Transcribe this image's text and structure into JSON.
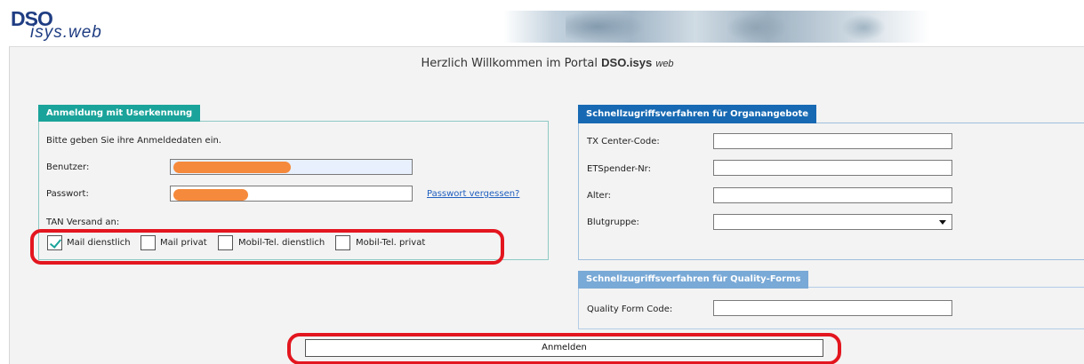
{
  "header": {
    "logo_top": "DSO",
    "logo_bottom": "isys.web",
    "photo": "header-banner-photo"
  },
  "welcome": {
    "prefix": "Herzlich Willkommen im Portal ",
    "brand": "DSO.isys",
    "suffix": "web"
  },
  "login_panel": {
    "tab": "Anmeldung mit Userkennung",
    "intro": "Bitte geben Sie ihre Anmeldedaten ein.",
    "user_label": "Benutzer:",
    "user_value": "",
    "password_label": "Passwort:",
    "password_value": "",
    "forgot_link": "Passwort vergessen?",
    "tan_label": "TAN Versand an:",
    "tan_options": [
      {
        "label": "Mail dienstlich",
        "checked": true
      },
      {
        "label": "Mail privat",
        "checked": false
      },
      {
        "label": "Mobil-Tel. dienstlich",
        "checked": false
      },
      {
        "label": "Mobil-Tel. privat",
        "checked": false
      }
    ]
  },
  "organ_panel": {
    "tab": "Schnellzugriffsverfahren für Organangebote",
    "fields": [
      {
        "label": "TX Center-Code:",
        "value": ""
      },
      {
        "label": "ETSpender-Nr:",
        "value": ""
      },
      {
        "label": "Alter:",
        "value": ""
      }
    ],
    "blood_label": "Blutgruppe:",
    "blood_value": ""
  },
  "quality_panel": {
    "tab": "Schnellzugriffsverfahren für Quality-Forms",
    "code_label": "Quality Form Code:",
    "code_value": ""
  },
  "login_button": "Anmelden",
  "colors": {
    "teal": "#1aa39a",
    "blue": "#1769b3",
    "light_blue": "#79a9d6",
    "annotation_red": "#e3161f",
    "redaction_orange": "#f58a3c"
  }
}
